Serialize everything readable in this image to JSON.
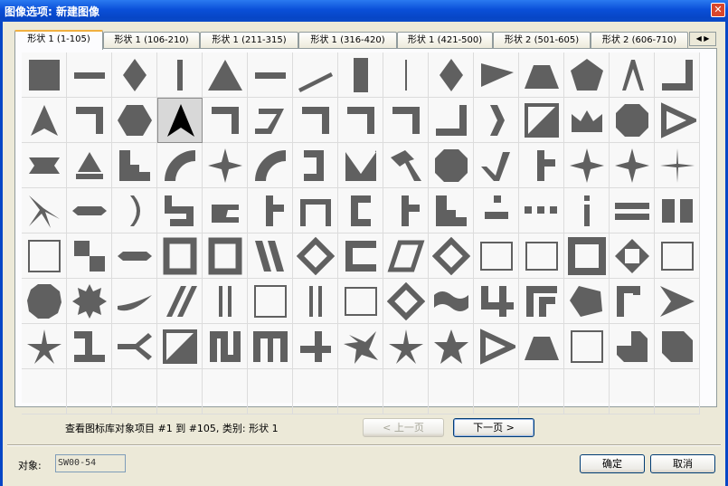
{
  "window": {
    "title": "图像选项: 新建图像",
    "close_glyph": "✕"
  },
  "tabs": [
    {
      "label": "形状 1 (1-105)",
      "active": true
    },
    {
      "label": "形状 1 (106-210)"
    },
    {
      "label": "形状 1 (211-315)"
    },
    {
      "label": "形状 1 (316-420)"
    },
    {
      "label": "形状 1 (421-500)"
    },
    {
      "label": "形状 2 (501-605)"
    },
    {
      "label": "形状 2 (606-710)"
    }
  ],
  "tab_scroll": {
    "left": "◀",
    "right": "▶"
  },
  "shape_grid": {
    "columns": 15,
    "rows": 8,
    "fill_color": "#606060",
    "selected_fill": "#000000",
    "selected_index": 18,
    "shapes": [
      "square",
      "h-bar",
      "diamond",
      "v-bar",
      "triangle",
      "h-bar",
      "slash",
      "tall-rect",
      "thin-v",
      "diamond",
      "pennant",
      "trapezoid",
      "pentagon",
      "caret-thin",
      "corner-l",
      "tri-notched",
      "corner-7",
      "hexagon",
      "arrowhead",
      "corner-7",
      "z-bar",
      "corner-7",
      "corner-7",
      "corner-7",
      "corner-l",
      "chevron-r",
      "split-square",
      "crown",
      "octagon",
      "tri-outline",
      "bowtie",
      "triangle-bar",
      "step",
      "quarter-arc",
      "star4",
      "quarter-arc",
      "bracket-r",
      "v-notch",
      "pick",
      "octagon",
      "check",
      "tee",
      "star4",
      "star4",
      "thin-star",
      "x-thin",
      "capsule",
      "arc",
      "step-s",
      "ledge",
      "tee",
      "table",
      "bracket-l",
      "tee",
      "step",
      "dash-stack",
      "dash-row",
      "exclam",
      "eq",
      "double-bar",
      "square-outline",
      "checker",
      "capsule",
      "ring-rect",
      "ring-rect",
      "stripes",
      "diamond-outline",
      "bracket",
      "para-outline",
      "diamond-outline",
      "rect-outline",
      "rect-outline",
      "square-ring",
      "diamond-in-sq",
      "rect-outline",
      "dodecagon",
      "starburst",
      "swoosh",
      "double-slash",
      "double-bar-thin",
      "square-outline",
      "double-bar-thin",
      "rect-outline",
      "diamond-outline",
      "wave",
      "frame-4",
      "frame-c",
      "pentagon-tilt",
      "frame-l",
      "arrowhead-r",
      "star5-thin",
      "cleat",
      "branch",
      "split-square",
      "frame-n",
      "frame-pi",
      "step-down",
      "star5-odd",
      "star5-thin",
      "star5",
      "tri-outline",
      "trapezoid",
      "square-outline",
      "fold",
      "octagon-cut",
      "",
      "",
      "",
      "",
      "",
      "",
      "",
      "",
      "",
      "",
      "",
      "",
      "",
      "",
      ""
    ]
  },
  "status_text": "查看图标库对象项目 #1 到 #105, 类别: 形状 1",
  "nav": {
    "prev_label": "< 上一页",
    "next_label": "下一页 >"
  },
  "object": {
    "label": "对象:",
    "value": "SW00-54"
  },
  "buttons": {
    "ok": "确定",
    "cancel": "取消"
  }
}
